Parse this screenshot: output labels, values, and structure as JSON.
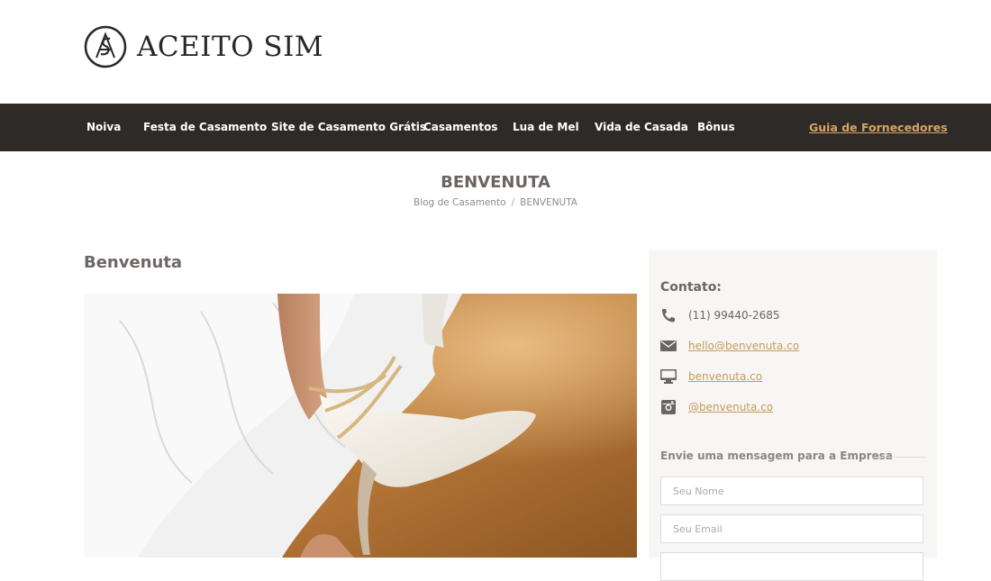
{
  "brand": {
    "name": "ACEITO SIM"
  },
  "nav": {
    "items": [
      {
        "label": "Noiva"
      },
      {
        "label": "Festa de Casamento"
      },
      {
        "label": "Site de Casamento Grátis"
      },
      {
        "label": "Casamentos"
      },
      {
        "label": "Lua de Mel"
      },
      {
        "label": "Vida de Casada"
      },
      {
        "label": "Bônus"
      }
    ],
    "featured": "Guia de Fornecedores"
  },
  "page": {
    "title": "BENVENUTA",
    "breadcrumb": [
      "Blog de Casamento",
      "BENVENUTA"
    ],
    "breadcrumb_separator": "/"
  },
  "article": {
    "title": "Benvenuta"
  },
  "sidebar": {
    "contact_title": "Contato:",
    "phone": "(11) 99440-2685",
    "email": "hello@benvenuta.co",
    "website": "benvenuta.co",
    "instagram": "@benvenuta.co",
    "message_title": "Envie uma mensagem para a Empresa",
    "name_placeholder": "Seu Nome",
    "email_placeholder": "Seu Email"
  },
  "colors": {
    "nav_bg": "#2e2a27",
    "accent": "#d7a462",
    "sidebar_bg": "#f7f6f5"
  },
  "icons": [
    "monogram-logo",
    "phone-icon",
    "envelope-icon",
    "monitor-icon",
    "instagram-icon"
  ]
}
